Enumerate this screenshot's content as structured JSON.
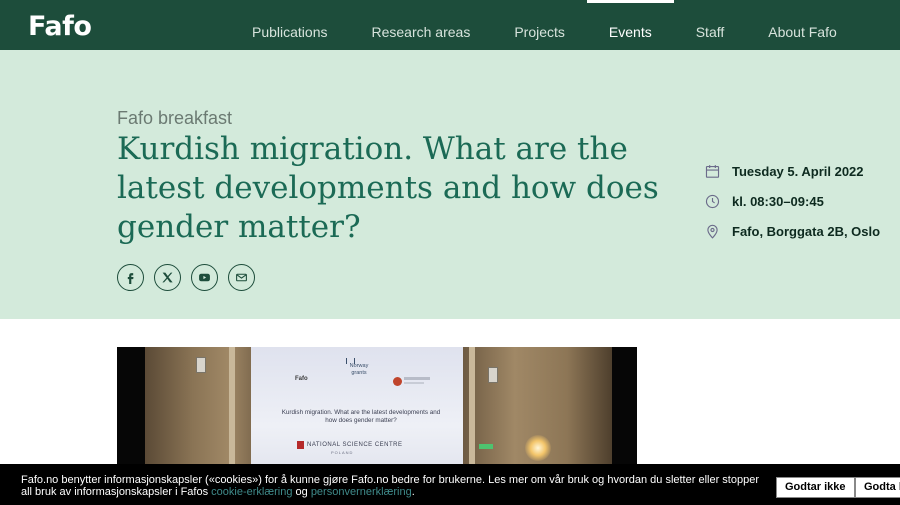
{
  "header": {
    "logo": "Fafo",
    "nav": [
      {
        "label": "Publications",
        "active": false
      },
      {
        "label": "Research areas",
        "active": false
      },
      {
        "label": "Projects",
        "active": false
      },
      {
        "label": "Events",
        "active": true
      },
      {
        "label": "Staff",
        "active": false
      },
      {
        "label": "About Fafo",
        "active": false
      }
    ]
  },
  "event": {
    "kicker": "Fafo breakfast",
    "title": "Kurdish migration. What are the latest developments and how does gender matter?",
    "date": "Tuesday 5. April 2022",
    "time": "kl. 08:30–09:45",
    "location": "Fafo, Borggata 2B, Oslo",
    "share_icons": [
      "facebook-icon",
      "x-icon",
      "youtube-icon",
      "email-icon"
    ]
  },
  "video": {
    "screen_logo_left": "Fafo",
    "screen_logo_mid": "Norway grants",
    "screen_title": "Kurdish migration. What are the latest developments and how does gender matter?",
    "screen_footer": "NATIONAL SCIENCE CENTRE",
    "screen_footer_sub": "POLAND"
  },
  "cookie": {
    "text_before": "Fafo.no benytter informasjonskapsler («cookies») for å kunne gjøre Fafo.no bedre for brukerne. Les mer om vår bruk og hvordan du sletter eller stopper all bruk av informasjonskapsler i Fafos ",
    "link1": "cookie-erklæring",
    "text_mid": " og ",
    "link2": "personvernerklæring",
    "text_after": ".",
    "decline_label": "Godtar ikke",
    "accept_label": "Godta b"
  },
  "colors": {
    "header_bg": "#1d4d3b",
    "hero_bg": "#d3eadb",
    "title": "#1b6a55"
  }
}
